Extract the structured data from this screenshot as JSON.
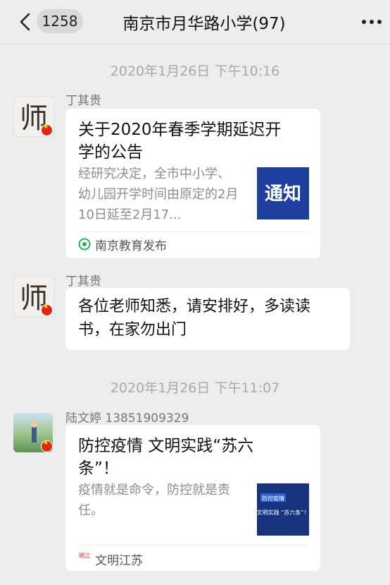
{
  "nav": {
    "back_icon": "chevron-left-icon",
    "unread_count": "1258",
    "title": "南京市月华路小学(97)",
    "more_icon": "more-dots-icon"
  },
  "messages": [
    {
      "timestamp": "2020年1月26日 下午10:16",
      "sender": "丁其贵",
      "avatar_glyph": "师",
      "type": "article",
      "title": "关于2020年春季学期延迟开学的公告",
      "desc": "经研究决定，全市中小学、幼儿园开学时间由原定的2月10日延至2月17...",
      "thumb_text": "通知",
      "source": "南京教育发布"
    },
    {
      "sender": "丁其贵",
      "avatar_glyph": "师",
      "type": "text",
      "text": "各位老师知悉，请安排好，多读读书，在家勿出门"
    },
    {
      "timestamp": "2020年1月26日 下午11:07",
      "sender": "陆文婷 13851909329",
      "type": "article",
      "title": "防控疫情 文明实践“苏六条”！",
      "desc": "疫情就是命令，防控就是责任。",
      "thumb_tag": "防控疫情",
      "thumb_text": "文明实践 “苏六条”！",
      "source_logo": "文明江苏",
      "source": "文明江苏"
    }
  ],
  "colors": {
    "background": "#ededed",
    "thumb_blue": "#1f3f9e",
    "thumb_navy": "#18337d"
  }
}
